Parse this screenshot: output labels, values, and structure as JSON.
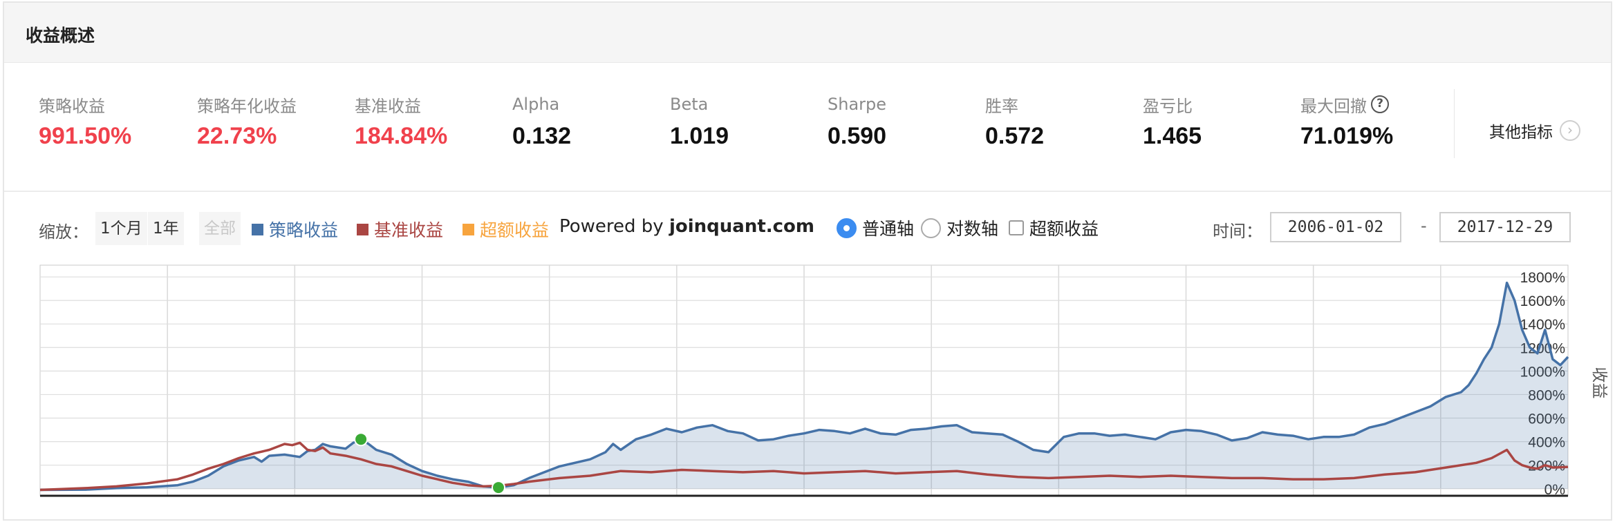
{
  "header": {
    "title": "收益概述"
  },
  "metrics": [
    {
      "label": "策略收益",
      "value": "991.50%",
      "red": true
    },
    {
      "label": "策略年化收益",
      "value": "22.73%",
      "red": true
    },
    {
      "label": "基准收益",
      "value": "184.84%",
      "red": true
    },
    {
      "label": "Alpha",
      "value": "0.132",
      "red": false
    },
    {
      "label": "Beta",
      "value": "1.019",
      "red": false
    },
    {
      "label": "Sharpe",
      "value": "0.590",
      "red": false
    },
    {
      "label": "胜率",
      "value": "0.572",
      "red": false
    },
    {
      "label": "盈亏比",
      "value": "1.465",
      "red": false
    },
    {
      "label": "最大回撤",
      "value": "71.019%",
      "red": false,
      "help_icon": "question-icon"
    }
  ],
  "more_metrics": {
    "label": "其他指标",
    "icon": "chevron-right-icon"
  },
  "toolbar": {
    "zoom_label": "缩放：",
    "zoom_buttons": [
      "1个月",
      "1年",
      "全部"
    ],
    "legend": [
      {
        "label": "策略收益",
        "color": "#4572a7"
      },
      {
        "label": "基准收益",
        "color": "#aa4643"
      },
      {
        "label": "超额收益",
        "color": "#f7a43e"
      }
    ],
    "powered_prefix": "Powered by",
    "powered_site": "joinquant.com",
    "options": [
      {
        "label": "普通轴",
        "type": "radio",
        "selected": true
      },
      {
        "label": "对数轴",
        "type": "radio",
        "selected": false
      },
      {
        "label": "超额收益",
        "type": "checkbox",
        "checked": false
      }
    ],
    "time_label": "时间：",
    "start_date": "2006-01-02",
    "date_separator": "-",
    "end_date": "2017-12-29"
  },
  "chart_data": {
    "type": "area",
    "x_domain": [
      "2006-01-02",
      "2017-12-29"
    ],
    "ylim": [
      -60,
      1900
    ],
    "yticks": [
      0,
      200,
      400,
      600,
      800,
      1000,
      1200,
      1400,
      1600,
      1800
    ],
    "ytick_labels": [
      "0%",
      "200%",
      "400%",
      "600%",
      "800%",
      "1000%",
      "1200%",
      "1400%",
      "1600%",
      "1800%"
    ],
    "ylabel": "收益",
    "grid": true,
    "series": [
      {
        "name": "策略收益",
        "color": "#4572a7",
        "fill": true,
        "points": [
          [
            0,
            -10
          ],
          [
            0.03,
            -8
          ],
          [
            0.05,
            5
          ],
          [
            0.07,
            12
          ],
          [
            0.09,
            30
          ],
          [
            0.1,
            60
          ],
          [
            0.11,
            110
          ],
          [
            0.12,
            190
          ],
          [
            0.13,
            240
          ],
          [
            0.14,
            270
          ],
          [
            0.145,
            230
          ],
          [
            0.15,
            280
          ],
          [
            0.16,
            290
          ],
          [
            0.17,
            270
          ],
          [
            0.175,
            320
          ],
          [
            0.18,
            330
          ],
          [
            0.185,
            380
          ],
          [
            0.19,
            360
          ],
          [
            0.2,
            340
          ],
          [
            0.205,
            390
          ],
          [
            0.21,
            420
          ],
          [
            0.215,
            380
          ],
          [
            0.22,
            330
          ],
          [
            0.23,
            290
          ],
          [
            0.24,
            210
          ],
          [
            0.25,
            150
          ],
          [
            0.26,
            110
          ],
          [
            0.27,
            80
          ],
          [
            0.28,
            60
          ],
          [
            0.29,
            20
          ],
          [
            0.3,
            10
          ],
          [
            0.31,
            30
          ],
          [
            0.32,
            90
          ],
          [
            0.33,
            140
          ],
          [
            0.34,
            190
          ],
          [
            0.35,
            220
          ],
          [
            0.36,
            250
          ],
          [
            0.37,
            310
          ],
          [
            0.375,
            380
          ],
          [
            0.38,
            330
          ],
          [
            0.39,
            420
          ],
          [
            0.4,
            460
          ],
          [
            0.41,
            510
          ],
          [
            0.42,
            480
          ],
          [
            0.43,
            520
          ],
          [
            0.44,
            540
          ],
          [
            0.45,
            490
          ],
          [
            0.46,
            470
          ],
          [
            0.47,
            410
          ],
          [
            0.48,
            420
          ],
          [
            0.49,
            450
          ],
          [
            0.5,
            470
          ],
          [
            0.51,
            500
          ],
          [
            0.52,
            490
          ],
          [
            0.53,
            470
          ],
          [
            0.54,
            510
          ],
          [
            0.55,
            470
          ],
          [
            0.56,
            460
          ],
          [
            0.57,
            500
          ],
          [
            0.58,
            510
          ],
          [
            0.59,
            530
          ],
          [
            0.6,
            540
          ],
          [
            0.61,
            480
          ],
          [
            0.62,
            470
          ],
          [
            0.63,
            460
          ],
          [
            0.64,
            400
          ],
          [
            0.65,
            330
          ],
          [
            0.66,
            310
          ],
          [
            0.67,
            440
          ],
          [
            0.68,
            470
          ],
          [
            0.69,
            470
          ],
          [
            0.7,
            450
          ],
          [
            0.71,
            460
          ],
          [
            0.72,
            440
          ],
          [
            0.73,
            420
          ],
          [
            0.74,
            480
          ],
          [
            0.75,
            500
          ],
          [
            0.76,
            490
          ],
          [
            0.77,
            460
          ],
          [
            0.78,
            410
          ],
          [
            0.79,
            430
          ],
          [
            0.8,
            480
          ],
          [
            0.81,
            460
          ],
          [
            0.82,
            450
          ],
          [
            0.83,
            420
          ],
          [
            0.84,
            440
          ],
          [
            0.85,
            440
          ],
          [
            0.86,
            460
          ],
          [
            0.87,
            520
          ],
          [
            0.88,
            550
          ],
          [
            0.89,
            600
          ],
          [
            0.9,
            650
          ],
          [
            0.91,
            700
          ],
          [
            0.92,
            780
          ],
          [
            0.93,
            820
          ],
          [
            0.935,
            880
          ],
          [
            0.94,
            980
          ],
          [
            0.945,
            1100
          ],
          [
            0.95,
            1200
          ],
          [
            0.955,
            1400
          ],
          [
            0.96,
            1750
          ],
          [
            0.965,
            1600
          ],
          [
            0.97,
            1350
          ],
          [
            0.975,
            1200
          ],
          [
            0.98,
            1150
          ],
          [
            0.985,
            1350
          ],
          [
            0.99,
            1100
          ],
          [
            0.995,
            1050
          ],
          [
            1.0,
            1120
          ]
        ]
      },
      {
        "name": "基准收益",
        "color": "#aa4643",
        "fill": false,
        "points": [
          [
            0,
            -10
          ],
          [
            0.03,
            5
          ],
          [
            0.05,
            20
          ],
          [
            0.07,
            45
          ],
          [
            0.09,
            80
          ],
          [
            0.1,
            120
          ],
          [
            0.11,
            170
          ],
          [
            0.12,
            210
          ],
          [
            0.13,
            260
          ],
          [
            0.14,
            300
          ],
          [
            0.15,
            330
          ],
          [
            0.16,
            380
          ],
          [
            0.165,
            370
          ],
          [
            0.17,
            390
          ],
          [
            0.175,
            330
          ],
          [
            0.18,
            320
          ],
          [
            0.185,
            350
          ],
          [
            0.19,
            300
          ],
          [
            0.2,
            280
          ],
          [
            0.21,
            250
          ],
          [
            0.22,
            210
          ],
          [
            0.23,
            190
          ],
          [
            0.24,
            150
          ],
          [
            0.25,
            110
          ],
          [
            0.26,
            80
          ],
          [
            0.27,
            50
          ],
          [
            0.28,
            30
          ],
          [
            0.29,
            20
          ],
          [
            0.3,
            25
          ],
          [
            0.31,
            40
          ],
          [
            0.32,
            60
          ],
          [
            0.34,
            90
          ],
          [
            0.36,
            110
          ],
          [
            0.38,
            150
          ],
          [
            0.4,
            140
          ],
          [
            0.42,
            160
          ],
          [
            0.44,
            150
          ],
          [
            0.46,
            140
          ],
          [
            0.48,
            150
          ],
          [
            0.5,
            130
          ],
          [
            0.52,
            140
          ],
          [
            0.54,
            150
          ],
          [
            0.56,
            130
          ],
          [
            0.58,
            140
          ],
          [
            0.6,
            150
          ],
          [
            0.62,
            120
          ],
          [
            0.64,
            100
          ],
          [
            0.66,
            90
          ],
          [
            0.68,
            100
          ],
          [
            0.7,
            110
          ],
          [
            0.72,
            100
          ],
          [
            0.74,
            110
          ],
          [
            0.76,
            100
          ],
          [
            0.78,
            90
          ],
          [
            0.8,
            90
          ],
          [
            0.82,
            80
          ],
          [
            0.84,
            80
          ],
          [
            0.86,
            90
          ],
          [
            0.88,
            120
          ],
          [
            0.9,
            140
          ],
          [
            0.92,
            180
          ],
          [
            0.94,
            220
          ],
          [
            0.95,
            260
          ],
          [
            0.96,
            330
          ],
          [
            0.965,
            240
          ],
          [
            0.97,
            200
          ],
          [
            0.975,
            180
          ],
          [
            0.98,
            170
          ],
          [
            0.985,
            200
          ],
          [
            0.99,
            180
          ],
          [
            1.0,
            185
          ]
        ]
      }
    ],
    "markers": [
      {
        "x": 0.21,
        "y": 420,
        "color": "#3aaa35"
      },
      {
        "x": 0.3,
        "y": 10,
        "color": "#3aaa35"
      }
    ]
  }
}
